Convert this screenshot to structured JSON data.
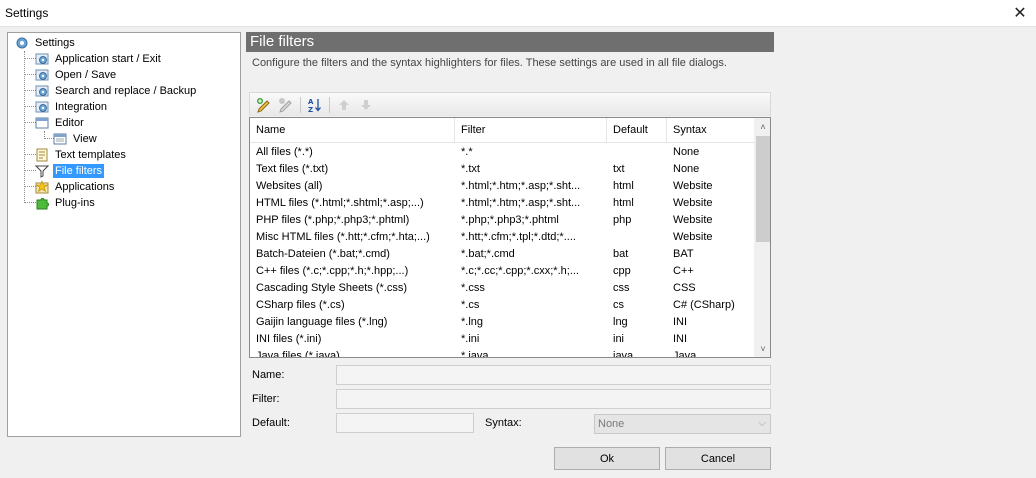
{
  "window": {
    "title": "Settings",
    "close_glyph": "✕"
  },
  "tree": [
    {
      "id": "settings",
      "label": "Settings",
      "icon": "gear-icon",
      "level": 0
    },
    {
      "id": "app-start",
      "label": "Application start / Exit",
      "icon": "gear-icon",
      "level": 1
    },
    {
      "id": "open-save",
      "label": "Open / Save",
      "icon": "gear-icon",
      "level": 1
    },
    {
      "id": "search-replace",
      "label": "Search and replace / Backup",
      "icon": "gear-icon",
      "level": 1
    },
    {
      "id": "integration",
      "label": "Integration",
      "icon": "gear-icon",
      "level": 1
    },
    {
      "id": "editor",
      "label": "Editor",
      "icon": "window-icon",
      "level": 1
    },
    {
      "id": "view",
      "label": "View",
      "icon": "window-icon",
      "level": 2
    },
    {
      "id": "text-templates",
      "label": "Text templates",
      "icon": "document-icon",
      "level": 1
    },
    {
      "id": "file-filters",
      "label": "File filters",
      "icon": "funnel-icon",
      "level": 1,
      "selected": true
    },
    {
      "id": "applications",
      "label": "Applications",
      "icon": "star-icon",
      "level": 1
    },
    {
      "id": "plug-ins",
      "label": "Plug-ins",
      "icon": "puzzle-icon",
      "level": 1
    }
  ],
  "panel": {
    "title": "File filters",
    "description": "Configure the filters and the syntax highlighters for files. These settings are used in all file dialogs."
  },
  "toolbar": [
    {
      "id": "add",
      "icon": "pencil-add-icon",
      "enabled": true
    },
    {
      "id": "delete",
      "icon": "pencil-delete-icon",
      "enabled": false
    },
    {
      "id": "sort",
      "icon": "sort-az-icon",
      "enabled": true
    },
    {
      "id": "move-up",
      "icon": "arrow-up-icon",
      "enabled": false
    },
    {
      "id": "move-down",
      "icon": "arrow-down-icon",
      "enabled": false
    }
  ],
  "list": {
    "columns": [
      "Name",
      "Filter",
      "Default",
      "Syntax"
    ],
    "rows": [
      [
        "All files (*.*)",
        "*.*",
        "",
        "None"
      ],
      [
        "Text files (*.txt)",
        "*.txt",
        "txt",
        "None"
      ],
      [
        "Websites (all)",
        "*.html;*.htm;*.asp;*.sht...",
        "html",
        "Website"
      ],
      [
        "HTML files (*.html;*.shtml;*.asp;...)",
        "*.html;*.htm;*.asp;*.sht...",
        "html",
        "Website"
      ],
      [
        "PHP files (*.php;*.php3;*.phtml)",
        "*.php;*.php3;*.phtml",
        "php",
        "Website"
      ],
      [
        "Misc HTML files (*.htt;*.cfm;*.hta;...)",
        "*.htt;*.cfm;*.tpl;*.dtd;*....",
        "",
        "Website"
      ],
      [
        "Batch-Dateien (*.bat;*.cmd)",
        "*.bat;*.cmd",
        "bat",
        "BAT"
      ],
      [
        "C++ files (*.c;*.cpp;*.h;*.hpp;...)",
        "*.c;*.cc;*.cpp;*.cxx;*.h;...",
        "cpp",
        "C++"
      ],
      [
        "Cascading Style Sheets (*.css)",
        "*.css",
        "css",
        "CSS"
      ],
      [
        "CSharp files (*.cs)",
        "*.cs",
        "cs",
        "C# (CSharp)"
      ],
      [
        "Gaijin language files (*.lng)",
        "*.lng",
        "lng",
        "INI"
      ],
      [
        "INI files (*.ini)",
        "*.ini",
        "ini",
        "INI"
      ],
      [
        "Java files (*.java)",
        "*.java",
        "java",
        "Java"
      ]
    ]
  },
  "form": {
    "name_label": "Name:",
    "filter_label": "Filter:",
    "default_label": "Default:",
    "syntax_label": "Syntax:",
    "name_value": "",
    "filter_value": "",
    "default_value": "",
    "syntax_value": "None"
  },
  "buttons": {
    "ok": "Ok",
    "cancel": "Cancel"
  }
}
